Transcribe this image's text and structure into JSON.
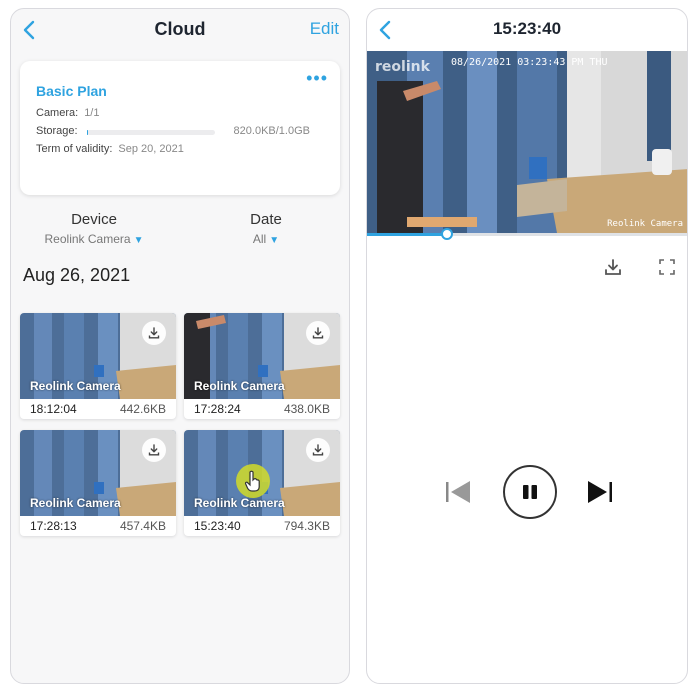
{
  "cloud_screen": {
    "title": "Cloud",
    "edit_label": "Edit",
    "plan": {
      "name": "Basic Plan",
      "camera_label": "Camera:",
      "camera_value": "1/1",
      "storage_label": "Storage:",
      "storage_value": "820.0KB/1.0GB",
      "storage_fraction": 0.0008,
      "validity_label": "Term of validity:",
      "validity_value": "Sep 20, 2021"
    },
    "filters": {
      "device_label": "Device",
      "device_value": "Reolink Camera",
      "date_label": "Date",
      "date_value": "All"
    },
    "date_header": "Aug 26, 2021",
    "clips": [
      {
        "camera": "Reolink Camera",
        "time": "18:12:04",
        "size": "442.6KB"
      },
      {
        "camera": "Reolink Camera",
        "time": "17:28:24",
        "size": "438.0KB"
      },
      {
        "camera": "Reolink Camera",
        "time": "17:28:13",
        "size": "457.4KB"
      },
      {
        "camera": "Reolink Camera",
        "time": "15:23:40",
        "size": "794.3KB"
      }
    ]
  },
  "player_screen": {
    "title": "15:23:40",
    "watermark": "reolink",
    "timestamp_overlay": "08/26/2021 03:23:43 PM THU",
    "camera_overlay": "Reolink Camera",
    "progress_fraction": 0.25,
    "state": "playing"
  },
  "icons": {
    "back": "chevron-left-icon",
    "more": "more-dots-icon",
    "download": "download-icon",
    "fullscreen": "fullscreen-icon",
    "previous": "skip-previous-icon",
    "pause": "pause-icon",
    "next": "skip-next-icon"
  },
  "colors": {
    "accent": "#2fa3e0",
    "touch_indicator": "#d2dc28"
  }
}
